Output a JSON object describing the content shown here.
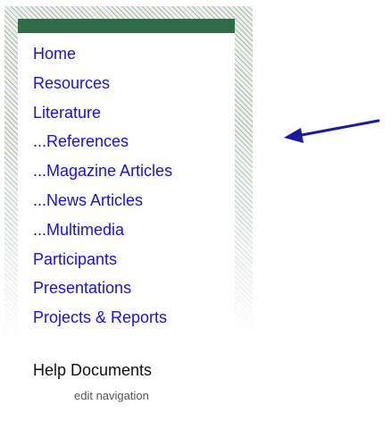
{
  "nav": {
    "items": [
      {
        "label": "Home"
      },
      {
        "label": "Resources"
      },
      {
        "label": "Literature"
      },
      {
        "label": "...References"
      },
      {
        "label": "...Magazine Articles"
      },
      {
        "label": "...News Articles"
      },
      {
        "label": "...Multimedia"
      },
      {
        "label": "Participants"
      },
      {
        "label": "Presentations"
      },
      {
        "label": "Projects & Reports"
      }
    ],
    "help_label": "Help Documents",
    "edit_label": "edit navigation"
  },
  "colors": {
    "link": "#1a11d6",
    "header_bar": "#2f6b49",
    "arrow": "#1a1aa0"
  },
  "annotation": {
    "arrow_icon": "left-arrow-icon"
  }
}
